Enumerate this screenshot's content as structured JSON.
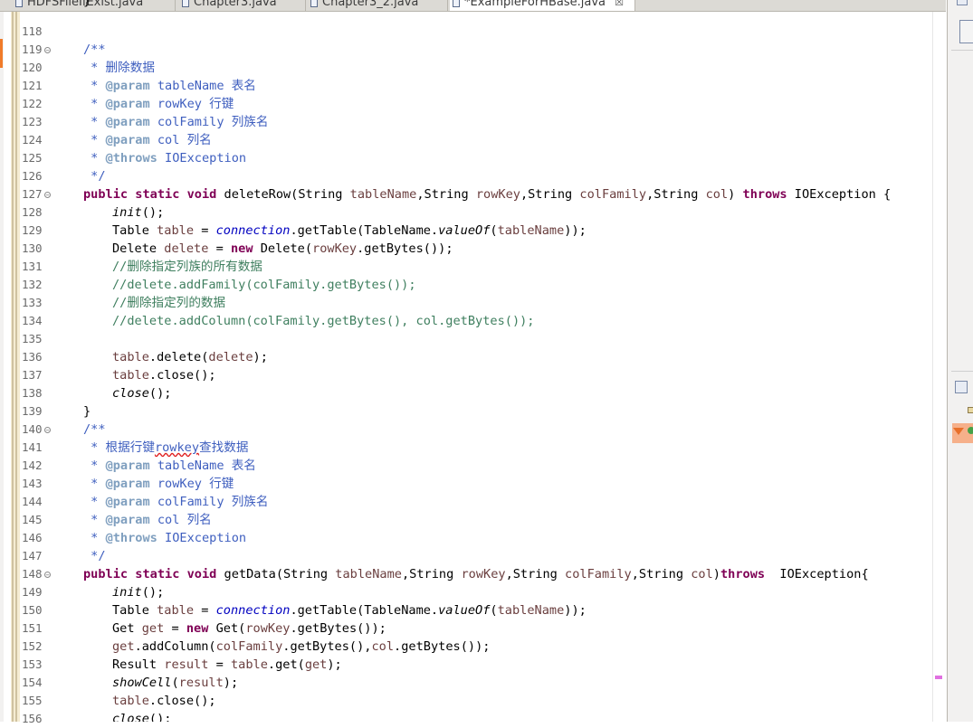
{
  "tabs": [
    {
      "label": "HDFSFileIfExist.java",
      "active": false
    },
    {
      "label": "Chapter3.java",
      "active": false
    },
    {
      "label": "Chapter3_2.java",
      "active": false
    },
    {
      "label": "*ExampleForHBase.java",
      "active": true
    }
  ],
  "tab_close_glyph": "☒",
  "editor": {
    "line_numbers": [
      "118",
      "119",
      "120",
      "121",
      "122",
      "123",
      "124",
      "125",
      "126",
      "127",
      "128",
      "129",
      "130",
      "131",
      "132",
      "133",
      "134",
      "135",
      "136",
      "137",
      "138",
      "139",
      "140",
      "141",
      "142",
      "143",
      "144",
      "145",
      "146",
      "147",
      "148",
      "149",
      "150",
      "151",
      "152",
      "153",
      "154",
      "155",
      "156"
    ],
    "fold_markers": [
      "119",
      "127",
      "140",
      "148"
    ],
    "lines": {
      "l117": "}",
      "l119": "/**",
      "l120": " * 删除数据",
      "l121_tag": "@param",
      "l121_rest": " tableName 表名",
      "l122_tag": "@param",
      "l122_rest": " rowKey 行键",
      "l123_tag": "@param",
      "l123_rest": " colFamily 列族名",
      "l124_tag": "@param",
      "l124_rest": " col 列名",
      "l125_tag": "@throws",
      "l125_rest": " IOException",
      "l126": " */",
      "l140": "/**",
      "l141_pre": " * 根据行键",
      "l141_spell": "rowkey",
      "l141_post": "查找数据",
      "l142_tag": "@param",
      "l142_rest": " tableName 表名",
      "l143_tag": "@param",
      "l143_rest": " rowKey 行键",
      "l144_tag": "@param",
      "l144_rest": " colFamily 列族名",
      "l145_tag": "@param",
      "l145_rest": " col 列名",
      "l146_tag": "@throws",
      "l146_rest": " IOException",
      "l147": " */",
      "c131": "//删除指定列族的所有数据",
      "c132": "//delete.addFamily(colFamily.getBytes());",
      "c133": "//删除指定列的数据",
      "c134": "//delete.addColumn(colFamily.getBytes(), col.getBytes());"
    }
  }
}
